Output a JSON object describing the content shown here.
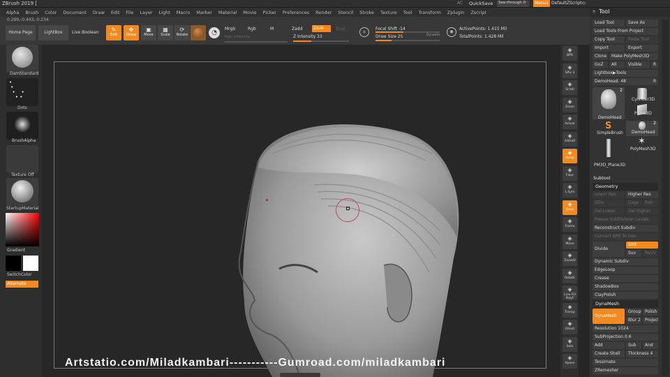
{
  "app_title": "ZBrush 2019 [",
  "titlebar_right": {
    "ac": "AC",
    "quicksave": "QuickSave",
    "seethrough": "See-through  0",
    "menus": "Menus",
    "script": "DefaultZScript"
  },
  "menu_items": [
    "Alpha",
    "Brush",
    "Color",
    "Document",
    "Draw",
    "Edit",
    "File",
    "Layer",
    "Light",
    "Macro",
    "Marker",
    "Material",
    "Movie",
    "Picker",
    "Preferences",
    "Render",
    "Stencil",
    "Stroke",
    "Texture",
    "Tool",
    "Transform",
    "Zplugin",
    "Zscript"
  ],
  "coords": "0.299,-0.443,-0.234",
  "shelf": {
    "home_page": "Home Page",
    "lightbox": "LightBox",
    "live_boolean": "Live Boolean",
    "edit": "Edit",
    "draw": "Draw",
    "move": "Move",
    "scale": "Scale",
    "rotate": "Rotate",
    "mrgb": "Mrgb",
    "rgb": "Rgb",
    "m": "M",
    "rgb_intensity": "Rgb Intensity",
    "zadd": "Zadd",
    "zsub": "Zsub",
    "zcut": "Zcut",
    "z_intensity": "Z Intensity 33",
    "focal_shift": "Focal Shift -14",
    "draw_size": "Draw Size 25",
    "dynamic": "Dynamic",
    "active_points": "ActivePoints: 1.415 Mil",
    "total_points": "TotalPoints: 1.428 Mil"
  },
  "levels": {
    "z_intensity": 0.33,
    "focal_shift": -14,
    "draw_size": 25
  },
  "left": {
    "brush": "DamStandard",
    "stroke": "Dots",
    "alpha": "BrushAlpha",
    "texture": "Texture Off",
    "material": "StartupMaterial",
    "gradient": "Gradient",
    "switch_color": "SwitchColor",
    "alternate": "Alternate"
  },
  "right_shelf": [
    "BPR",
    "SPix 3",
    "Scroll",
    "Zoom",
    "Actual",
    "AAHalf",
    "Persp",
    "Floor",
    "L.Sym",
    "Qxyz",
    "Frame",
    "Move",
    "ZoomD",
    "RotatE",
    "Line Fill PolyF",
    "Transp",
    "Ghost",
    "Solo",
    "Xpose"
  ],
  "tool_panel": {
    "title": "Tool",
    "load_tool": "Load Tool",
    "save_as": "Save As",
    "load_from_project": "Load Tools From Project",
    "copy_tool": "Copy Tool",
    "paste_tool": "Paste Tool",
    "import": "Import",
    "export": "Export",
    "clone": "Clone",
    "make_polymesh": "Make PolyMesh3D",
    "goz": "GoZ",
    "all": "All",
    "visible": "Visible",
    "r": "R",
    "lightbox_tools": "Lightbox▶Tools",
    "demohead": "DemoHead. 48",
    "tools": [
      {
        "name": "DemoHead",
        "count": "2"
      },
      {
        "name": "Cylinder3D",
        "count": ""
      },
      {
        "name": "Plane3D",
        "count": ""
      },
      {
        "name": "SimpleBrush",
        "count": ""
      },
      {
        "name": "DemoHead",
        "count": "2"
      },
      {
        "name": "PM3D_Plane3D",
        "count": ""
      },
      {
        "name": "PolyMesh3D",
        "count": ""
      }
    ],
    "subtool": "Subtool",
    "geometry": "Geometry",
    "lower_res": "Lower Res",
    "higher_res": "Higher Res",
    "sdiv": "SDiv",
    "cage": "Cage",
    "rstr": "Rstr",
    "del_lower": "Del Lower",
    "del_higher": "Del Higher",
    "freeze": "Freeze SubDivision Levels",
    "reconstruct": "Reconstruct Subdiv",
    "convert_bpr": "Convert BPR To Geo",
    "divide": "Divide",
    "smt": "Smt",
    "suv": "Suv",
    "reuv": "ReUV",
    "dynamic_subdiv": "Dynamic Subdiv",
    "edgeloop": "EdgeLoop",
    "crease": "Crease",
    "shadowbox": "ShadowBox",
    "claypolish": "ClayPolish",
    "dynamesh_header": "DynaMesh",
    "dynamesh": "DynaMesh",
    "groups": "Groups",
    "polish": "Polish",
    "blur": "Blur 2",
    "project": "Project",
    "resolution": "Resolution 1024",
    "subprojection": "SubProjection 0.6",
    "add": "Add",
    "sub": "Sub",
    "and": "And",
    "create_shell": "Create Shell",
    "thickness": "Thickness 4",
    "tessimate": "Tessimate",
    "zremesher": "ZRemesher"
  },
  "watermark": "Artstatio.com/Miladkambari-----------Gumroad.com/miladkambari",
  "colors": {
    "accent": "#f28a1f",
    "bg": "#262626",
    "panel": "#333333",
    "button": "#3e3e3e"
  }
}
